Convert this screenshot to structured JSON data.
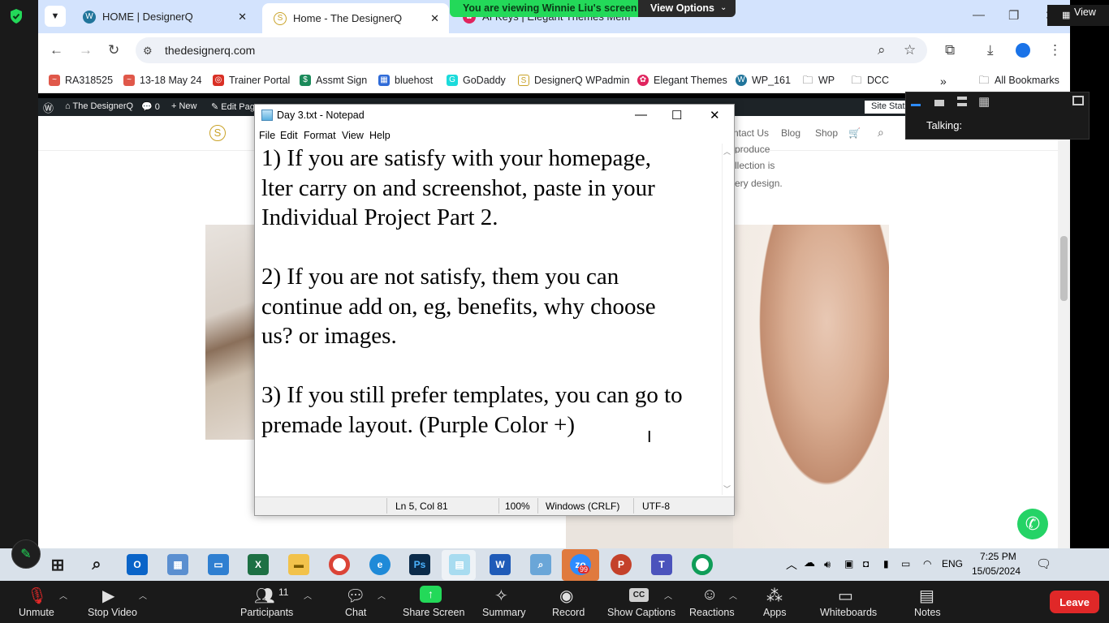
{
  "zoom_banner": {
    "viewing": "You are viewing Winnie Liu's screen",
    "options": "View Options",
    "view": "View"
  },
  "browser": {
    "tabs": [
      {
        "label": "HOME | DesignerQ",
        "icon": "wordpress-icon"
      },
      {
        "label": "Home - The DesignerQ",
        "icon": "designerq-icon"
      },
      {
        "label": "AI Keys | Elegant Themes Mem",
        "icon": "elegant-themes-icon"
      }
    ],
    "url": "thedesignerq.com",
    "bookmarks": [
      "RA318525",
      "13-18 May 24",
      "Trainer Portal",
      "Assmt Sign",
      "bluehost",
      "GoDaddy",
      "DesignerQ WPadmin",
      "Elegant Themes",
      "WP_161",
      "WP",
      "DCC"
    ],
    "all_bookmarks": "All Bookmarks"
  },
  "wp_admin_bar": {
    "site": "The DesignerQ",
    "comments": "0",
    "new": "+ New",
    "edit": "Edit Page",
    "status": "Site Status"
  },
  "site": {
    "nav": [
      "ntact Us",
      "Blog",
      "Shop"
    ],
    "snippet": [
      "produce",
      "llection is",
      "ery design."
    ]
  },
  "notepad": {
    "title": "Day 3.txt - Notepad",
    "menu": [
      "File",
      "Edit",
      "Format",
      "View",
      "Help"
    ],
    "content": "1) If you are satisfy with your homepage,\nlter carry on and screenshot, paste in your\nIndividual Project Part 2.\n\n2) If you are not satisfy, them you can\ncontinue add on, eg, benefits, why choose\nus? or images.\n\n3) If you still prefer templates, you can go to\npremade layout. (Purple Color +)",
    "status": {
      "position": "Ln 5, Col 81",
      "zoom": "100%",
      "eol": "Windows (CRLF)",
      "encoding": "UTF-8"
    }
  },
  "talk_panel": {
    "label": "Talking:"
  },
  "taskbar": {
    "lang": "ENG",
    "time": "7:25 PM",
    "date": "15/05/2024",
    "zoom_badge": "99"
  },
  "zoom_controls": {
    "unmute": "Unmute",
    "stop_video": "Stop Video",
    "participants": "Participants",
    "participants_count": "11",
    "chat": "Chat",
    "share": "Share Screen",
    "summary": "Summary",
    "record": "Record",
    "captions": "Show Captions",
    "reactions": "Reactions",
    "apps": "Apps",
    "whiteboards": "Whiteboards",
    "notes": "Notes",
    "leave": "Leave"
  },
  "colors": {
    "zoom_green": "#23d959",
    "leave_red": "#e02828",
    "chrome_tab_bg": "#d3e3fd",
    "wp_bar": "#1d2327"
  }
}
